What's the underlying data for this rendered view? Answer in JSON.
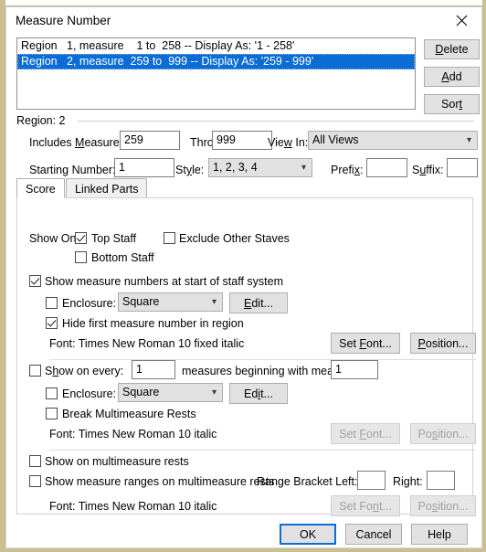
{
  "window": {
    "title": "Measure Number",
    "close_icon": "close-icon"
  },
  "regions": {
    "items": [
      {
        "text": "Region   1, measure    1 to  258 -- Display As: '1 - 258'",
        "selected": false
      },
      {
        "text": "Region   2, measure  259 to  999 -- Display As: '259 - 999'",
        "selected": true
      }
    ],
    "buttons": {
      "delete": "Delete",
      "delete_accel": "D",
      "add": "Add",
      "add_accel": "A",
      "sort": "Sort",
      "sort_accel": "t"
    }
  },
  "region_details": {
    "group_label": "Region: 2",
    "includes_measure_label": "Includes Measure:",
    "includes_measure_value": "259",
    "through_label": "Through:",
    "through_value": "999",
    "view_in_label": "View In:",
    "view_in_value": "All Views",
    "starting_number_label": "Starting Number:",
    "starting_number_value": "1",
    "style_label": "Style:",
    "style_value": "1, 2, 3, 4",
    "prefix_label": "Prefix:",
    "prefix_value": "",
    "suffix_label": "Suffix:",
    "suffix_value": ""
  },
  "tabs": [
    {
      "label": "Score",
      "active": true
    },
    {
      "label": "Linked Parts",
      "active": false
    }
  ],
  "score_tab": {
    "show_on_label": "Show On:",
    "top_staff": {
      "label": "Top Staff",
      "checked": true
    },
    "exclude_other_staves": {
      "label": "Exclude Other Staves",
      "checked": false
    },
    "bottom_staff": {
      "label": "Bottom Staff",
      "checked": false
    },
    "group1": {
      "main_checkbox": {
        "label": "Show measure numbers at start of staff system",
        "checked": true
      },
      "enclosure": {
        "label": "Enclosure:",
        "checked": false,
        "value": "Square"
      },
      "edit_button": "Edit...",
      "edit_accel": "E",
      "hide_first": {
        "label": "Hide first measure number in region",
        "checked": true
      },
      "font_text": "Font: Times New Roman 10 fixed  italic",
      "set_font_button": "Set Font...",
      "set_font_accel": "F",
      "position_button": "Position...",
      "position_accel": "P",
      "buttons_disabled": false
    },
    "group2": {
      "main_checkbox": {
        "label": "Show on every:",
        "checked": false
      },
      "every_value": "1",
      "middle_text": "measures beginning with measure:",
      "beginning_value": "1",
      "enclosure": {
        "label": "Enclosure:",
        "checked": false,
        "value": "Square"
      },
      "edit_button": "Edit...",
      "edit_accel": "i",
      "break_multimeasure": {
        "label": "Break Multimeasure Rests",
        "checked": false
      },
      "font_text": "Font:  Times New Roman 10  italic",
      "set_font_button": "Set Font...",
      "set_font_accel": "F",
      "position_button": "Position...",
      "position_accel": "s",
      "buttons_disabled": true
    },
    "group3": {
      "show_on_multimeasure": {
        "label": "Show on multimeasure rests",
        "checked": false
      },
      "show_ranges": {
        "label": "Show measure ranges on multimeasure rests",
        "checked": false
      },
      "range_bracket_left_label": "Range Bracket Left:",
      "range_bracket_left_value": "",
      "range_bracket_right_label": "Right:",
      "range_bracket_right_value": "",
      "font_text": "Font:  Times New Roman 10  italic",
      "set_font_button": "Set Font...",
      "set_font_accel": "n",
      "position_button": "Position...",
      "position_accel": "s",
      "buttons_disabled": true
    }
  },
  "footer": {
    "ok": "OK",
    "cancel": "Cancel",
    "help": "Help"
  },
  "colors": {
    "selection": "#0a6cd4",
    "focus_ring": "#0a6cd4",
    "dialog_bg": "#ffffff",
    "control_bg": "#e1e1e1",
    "desktop": "#c9bf93"
  }
}
